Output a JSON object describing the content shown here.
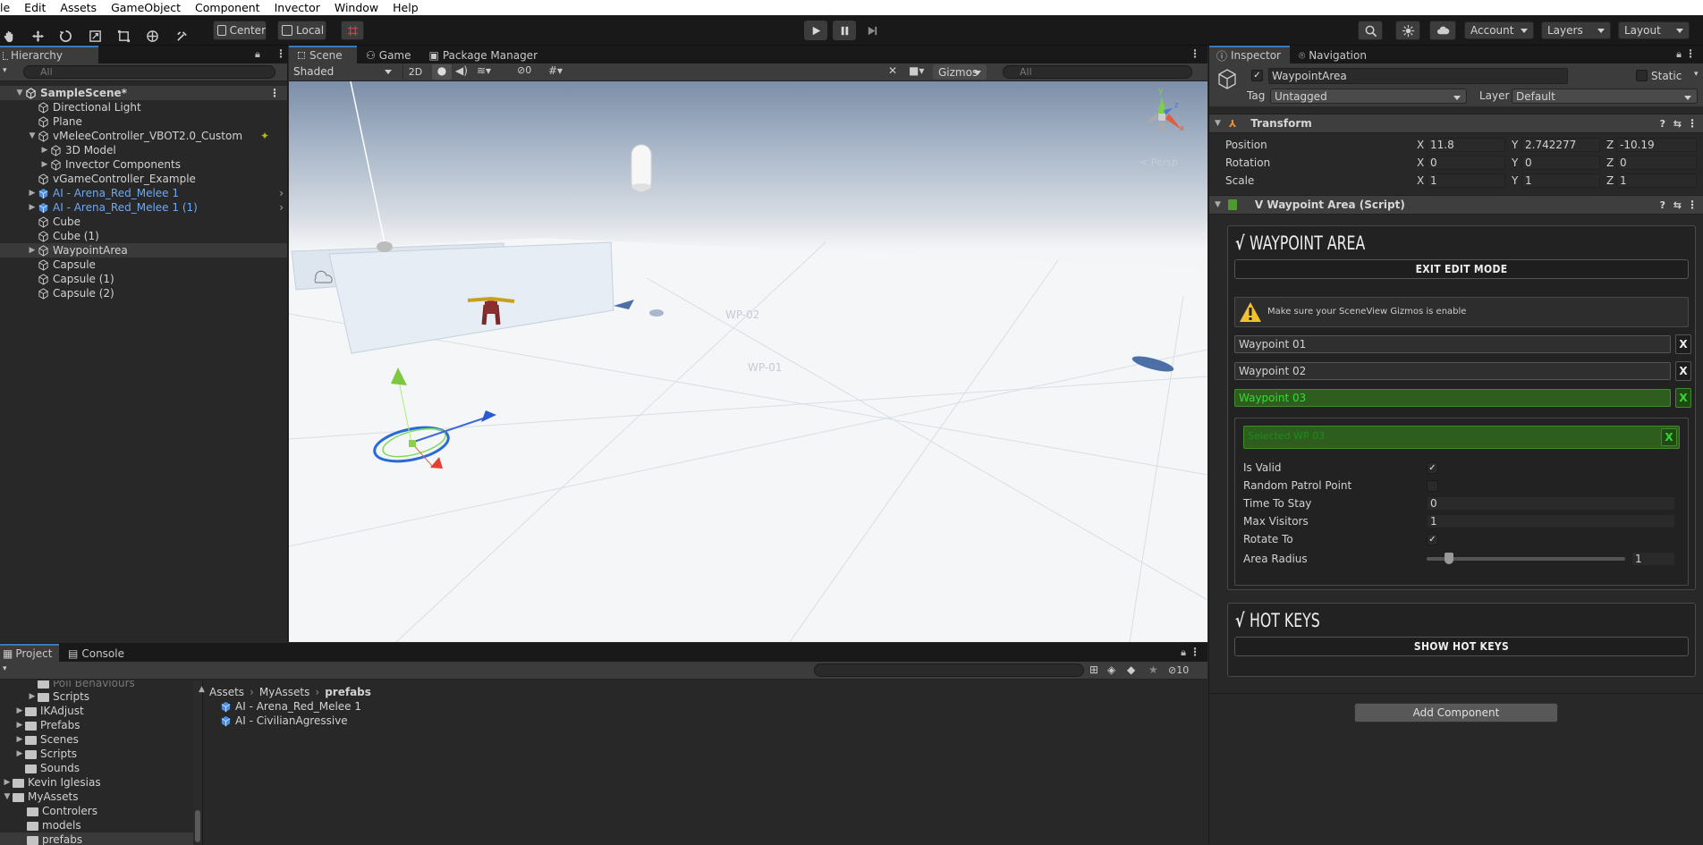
{
  "menu": [
    "le",
    "Edit",
    "Assets",
    "GameObject",
    "Component",
    "Invector",
    "Window",
    "Help"
  ],
  "toolbar": {
    "center_label": "Center",
    "local_label": "Local",
    "account_label": "Account",
    "layers_label": "Layers",
    "layout_label": "Layout"
  },
  "hierarchy": {
    "tab": "Hierarchy",
    "search_placeholder": "All",
    "scene": "SampleScene*",
    "items": [
      {
        "label": "Directional Light"
      },
      {
        "label": "Plane"
      },
      {
        "label": "vMeleeController_VBOT2.0_Custom"
      },
      {
        "label": "3D Model"
      },
      {
        "label": "Invector Components"
      },
      {
        "label": "vGameController_Example"
      },
      {
        "label": "AI - Arena_Red_Melee 1"
      },
      {
        "label": "AI - Arena_Red_Melee 1 (1)"
      },
      {
        "label": "Cube"
      },
      {
        "label": "Cube (1)"
      },
      {
        "label": "WaypointArea"
      },
      {
        "label": "Capsule"
      },
      {
        "label": "Capsule (1)"
      },
      {
        "label": "Capsule (2)"
      }
    ]
  },
  "scene_view": {
    "tabs": [
      "Scene",
      "Game",
      "Package Manager"
    ],
    "shading": "Shaded",
    "mode_2d": "2D",
    "hidden_count": "0",
    "gizmos": "Gizmos",
    "search_placeholder": "All",
    "persp": "< Persp",
    "wp_labels": [
      "WP-02",
      "WP-01"
    ],
    "gizmo_axes": {
      "x": "x",
      "y": "y",
      "z": "z"
    }
  },
  "project": {
    "tabs": [
      "Project",
      "Console"
    ],
    "count": "10",
    "breadcrumb": [
      "Assets",
      "MyAssets",
      "prefabs"
    ],
    "tree": [
      {
        "label": "Scripts"
      },
      {
        "label": "IKAdjust"
      },
      {
        "label": "Prefabs"
      },
      {
        "label": "Scenes"
      },
      {
        "label": "Scripts"
      },
      {
        "label": "Sounds"
      },
      {
        "label": "Kevin Iglesias"
      },
      {
        "label": "MyAssets"
      },
      {
        "label": "Controlers"
      },
      {
        "label": "models"
      },
      {
        "label": "prefabs"
      }
    ],
    "files": [
      "AI - Arena_Red_Melee 1",
      "AI - CivilianAgressive"
    ]
  },
  "inspector": {
    "tabs": [
      "Inspector",
      "Navigation"
    ],
    "object_name": "WaypointArea",
    "static_label": "Static",
    "tag_label": "Tag",
    "tag_value": "Untagged",
    "layer_label": "Layer",
    "layer_value": "Default",
    "transform": {
      "title": "Transform",
      "position": {
        "label": "Position",
        "x": "11.8",
        "y": "2.742277",
        "z": "-10.19"
      },
      "rotation": {
        "label": "Rotation",
        "x": "0",
        "y": "0",
        "z": "0"
      },
      "scale": {
        "label": "Scale",
        "x": "1",
        "y": "1",
        "z": "1"
      }
    },
    "script_title": "V Waypoint Area (Script)",
    "waypoint_area_title": "WAYPOINT AREA",
    "exit_edit_mode": "EXIT EDIT MODE",
    "warning": "Make sure your SceneView Gizmos is enable",
    "waypoints": [
      "Waypoint 01",
      "Waypoint 02",
      "Waypoint 03"
    ],
    "x_label": "X",
    "selected_wp": "Selected WP 03",
    "props": {
      "is_valid": {
        "label": "Is Valid",
        "checked": true
      },
      "random_patrol": {
        "label": "Random Patrol Point",
        "checked": false
      },
      "time_to_stay": {
        "label": "Time To Stay",
        "value": "0"
      },
      "max_visitors": {
        "label": "Max Visitors",
        "value": "1"
      },
      "rotate_to": {
        "label": "Rotate To",
        "checked": true
      },
      "area_radius": {
        "label": "Area Radius",
        "value": "1"
      }
    },
    "hot_keys_title": "HOT KEYS",
    "show_hot_keys": "SHOW HOT KEYS",
    "add_component": "Add Component"
  },
  "colors": {
    "accent": "#3a79bb",
    "waypoint_green": "#2d5e1e",
    "green_text": "#38d838"
  }
}
